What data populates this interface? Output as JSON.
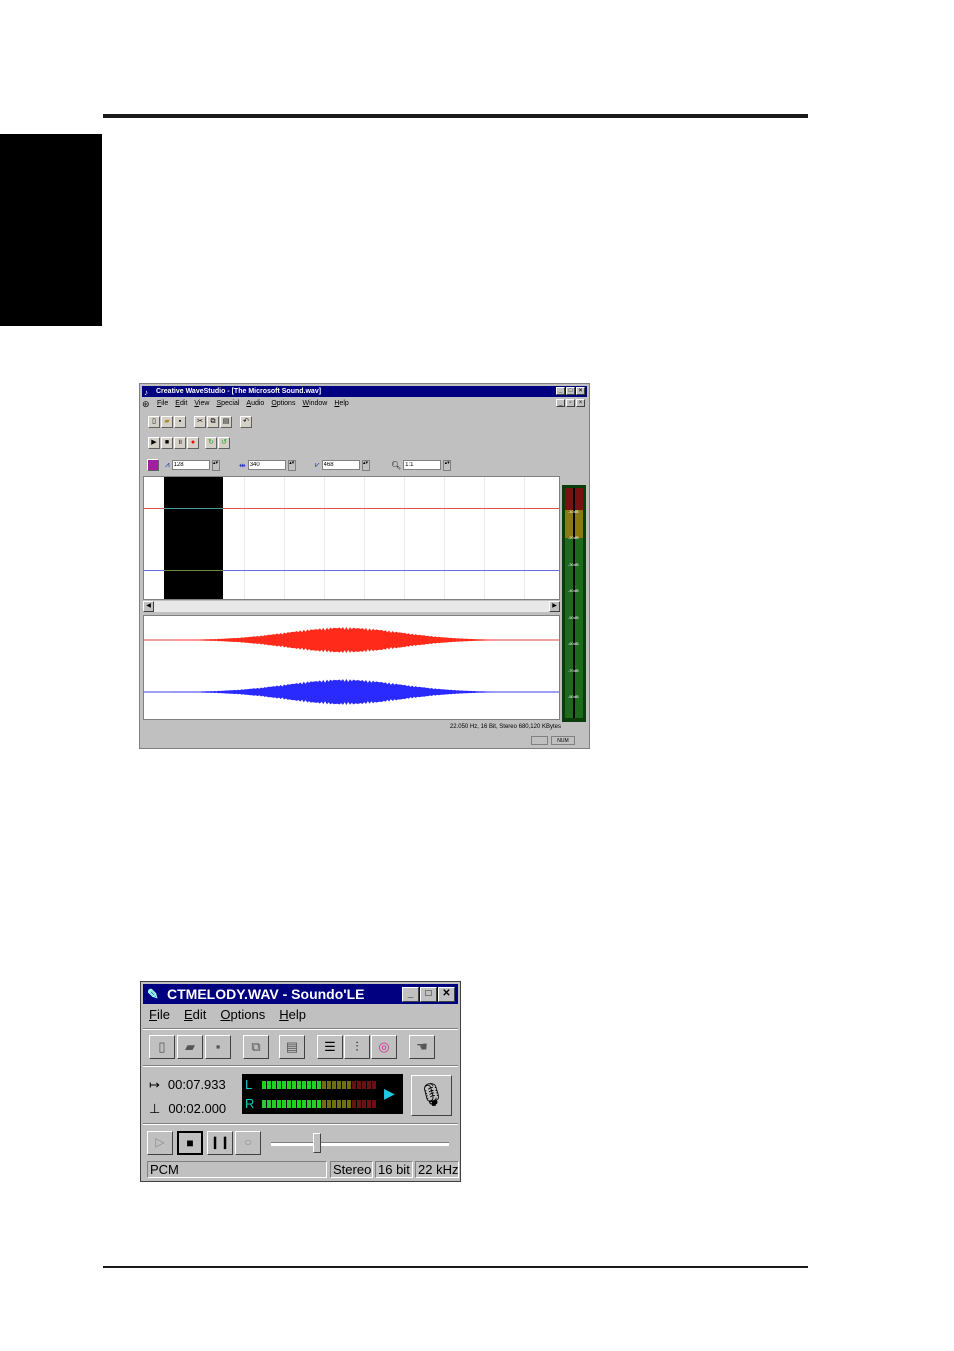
{
  "wavestudio": {
    "title": "Creative WaveStudio - [The Microsoft Sound.wav]",
    "menu": [
      "File",
      "Edit",
      "View",
      "Special",
      "Audio",
      "Options",
      "Window",
      "Help"
    ],
    "spin1": "128",
    "spin2": "340",
    "spin3": "468",
    "zoom": "1:1",
    "meter_ticks": [
      "-10dB",
      "-20dB",
      "-30dB",
      "-40dB",
      "-50dB",
      "-60dB",
      "-70dB",
      "-80dB"
    ],
    "status": "22.050 Hz, 16 Bit, Stereo 680,120 KBytes",
    "num": "NUM"
  },
  "soundo": {
    "title": "CTMELODY.WAV - Soundo'LE",
    "menu": [
      "File",
      "Edit",
      "Options",
      "Help"
    ],
    "length": "00:07.933",
    "position": "00:02.000",
    "left_channel": "L",
    "right_channel": "R",
    "format": "PCM",
    "channels": "Stereo",
    "bits": "16 bit",
    "rate": "22 kHz",
    "colors": {
      "meter_on": "#22d022",
      "meter_mid": "#c8c820",
      "meter_high": "#c02020"
    }
  }
}
